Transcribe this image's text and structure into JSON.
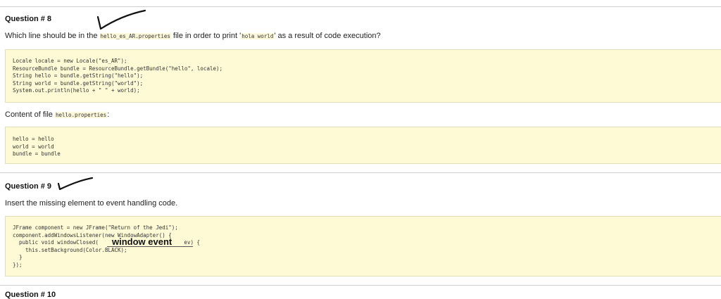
{
  "q8": {
    "title": "Question # 8",
    "prompt_a": "Which line should be in the ",
    "prompt_file": "hello_es_AR.properties",
    "prompt_b": " file in order to print '",
    "prompt_code": "hola world",
    "prompt_c": "' as a result of code execution?",
    "code_lines": [
      "Locale locale = new Locale(\"es_AR\");",
      "ResourceBundle bundle = ResourceBundle.getBundle(\"hello\", locale);",
      "String hello = bundle.getString(\"hello\");",
      "String world = bundle.getString(\"world\");",
      "System.out.println(hello + \" \" + world);"
    ],
    "content_label_a": "Content of file ",
    "content_file": "hello.properties",
    "content_label_b": ":",
    "props_lines": [
      "hello = hello",
      "world = world",
      "bundle = bundle"
    ]
  },
  "q9": {
    "title": "Question # 9",
    "prompt": "Insert the missing element to event handling code.",
    "code_lines": [
      "JFrame component = new JFrame(\"Return of the Jedi\");",
      "component.addWindowsListener(new WindowAdapter() {",
      "  public void windowClosed(",
      "    this.setBackground(Color.BLACK);",
      "  }",
      "});"
    ],
    "line3_suffix": " ev) {",
    "handwritten_answer": "window event"
  },
  "q10": {
    "title": "Question # 10"
  },
  "colors": {
    "code_bg": "#fdfad5",
    "inline_code_bg": "#fbf7d9",
    "rule": "#cfcfcf"
  }
}
